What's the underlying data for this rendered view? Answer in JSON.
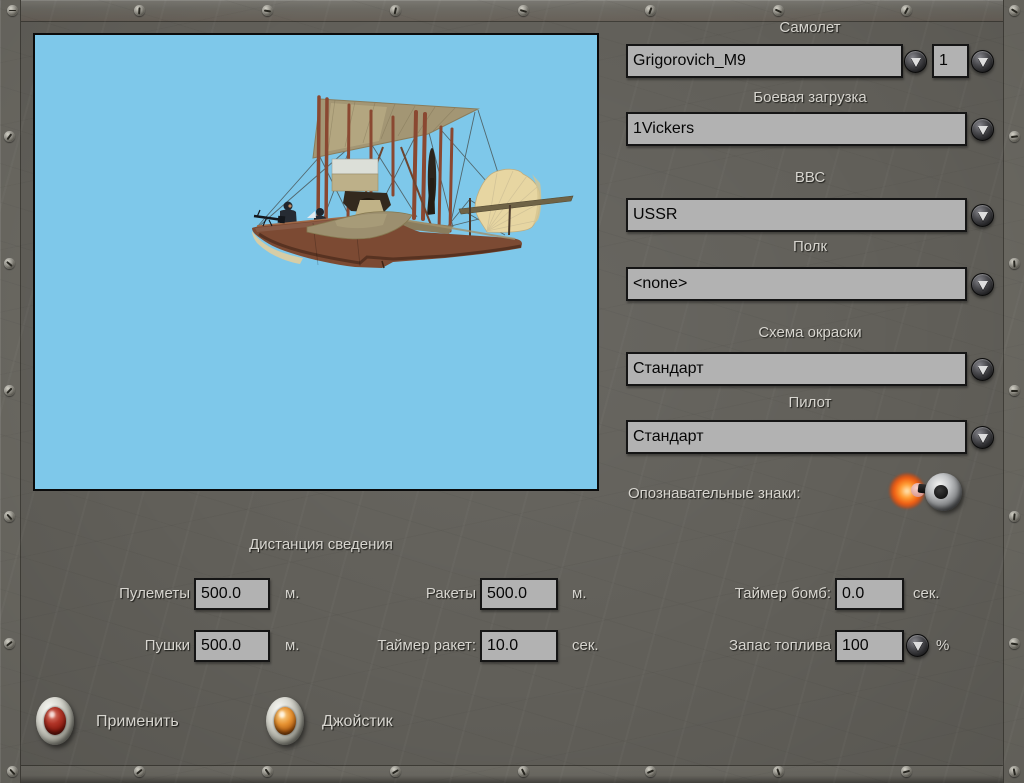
{
  "sections": {
    "aircraft": {
      "label": "Самолет",
      "value": "Grigorovich_M9",
      "count": "1"
    },
    "loadout": {
      "label": "Боевая загрузка",
      "value": "1Vickers"
    },
    "airforce": {
      "label": "ВВС",
      "value": "USSR"
    },
    "regiment": {
      "label": "Полк",
      "value": "<none>"
    },
    "paint_scheme": {
      "label": "Схема окраски",
      "value": "Стандарт"
    },
    "pilot": {
      "label": "Пилот",
      "value": "Стандарт"
    },
    "markings": {
      "label": "Опознавательные знаки:",
      "state": "on"
    }
  },
  "convergence": {
    "title": "Дистанция сведения",
    "machineguns": {
      "label": "Пулеметы",
      "value": "500.0",
      "unit": "м."
    },
    "cannons": {
      "label": "Пушки",
      "value": "500.0",
      "unit": "м."
    },
    "rockets": {
      "label": "Ракеты",
      "value": "500.0",
      "unit": "м."
    },
    "rocket_timer": {
      "label": "Таймер ракет:",
      "value": "10.0",
      "unit": "сек."
    },
    "bomb_timer": {
      "label": "Таймер бомб:",
      "value": "0.0",
      "unit": "сек."
    },
    "fuel": {
      "label": "Запас топлива",
      "value": "100",
      "unit": "%"
    }
  },
  "actions": {
    "apply": {
      "label": "Применить",
      "light_color": "#8a1b10"
    },
    "joystick": {
      "label": "Джойстик",
      "light_color": "#b25c10"
    }
  },
  "preview": {
    "aircraft": "Grigorovich M9 flying boat",
    "sky_color": "#7ec8ea"
  },
  "colors": {
    "background": "#615f59",
    "field_bg": "#b2b2b2",
    "label_text": "#d7d5cf",
    "indicator_glow": "#ff9c32"
  }
}
